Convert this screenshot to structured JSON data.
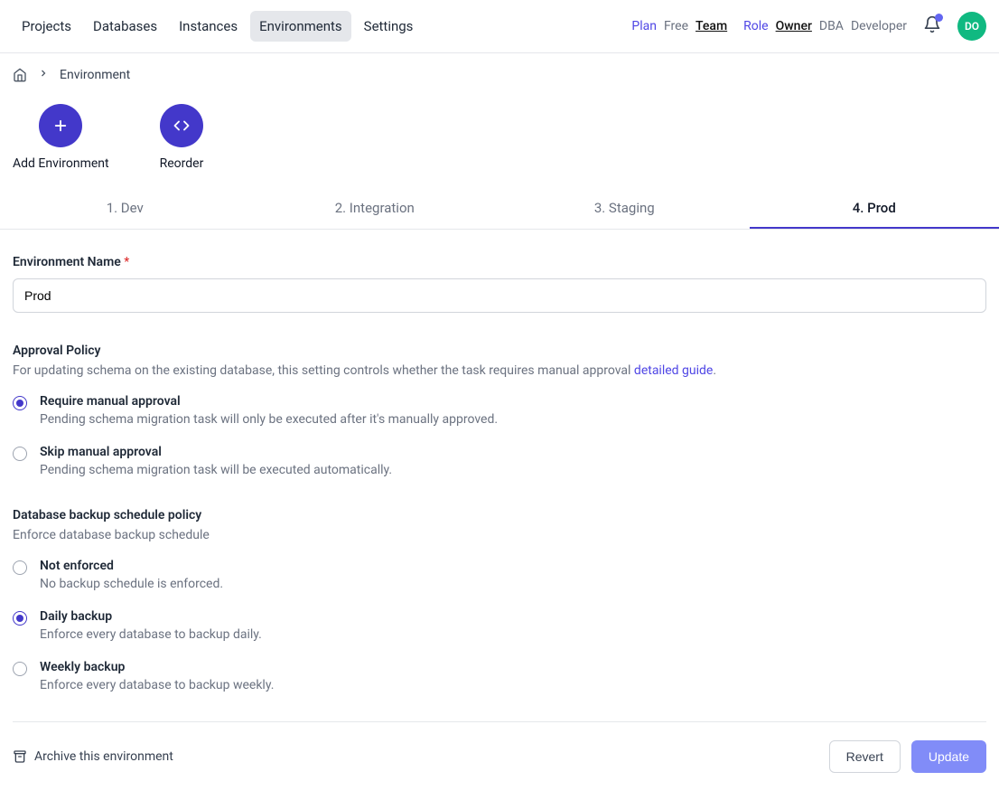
{
  "nav": {
    "items": [
      {
        "label": "Projects",
        "active": false
      },
      {
        "label": "Databases",
        "active": false
      },
      {
        "label": "Instances",
        "active": false
      },
      {
        "label": "Environments",
        "active": true
      },
      {
        "label": "Settings",
        "active": false
      }
    ],
    "plan_label": "Plan",
    "plan_free": "Free",
    "plan_team": "Team",
    "role_label": "Role",
    "role_owner": "Owner",
    "role_dba": "DBA",
    "role_developer": "Developer",
    "avatar_initials": "DO"
  },
  "breadcrumb": {
    "current": "Environment"
  },
  "actions": {
    "add": "Add Environment",
    "reorder": "Reorder"
  },
  "tabs": [
    {
      "label": "1. Dev",
      "active": false
    },
    {
      "label": "2. Integration",
      "active": false
    },
    {
      "label": "3. Staging",
      "active": false
    },
    {
      "label": "4. Prod",
      "active": true
    }
  ],
  "form": {
    "name_label": "Environment Name",
    "name_value": "Prod",
    "approval": {
      "title": "Approval Policy",
      "desc_prefix": "For updating schema on the existing database, this setting controls whether the task requires manual approval ",
      "link": "detailed guide",
      "desc_suffix": ".",
      "options": [
        {
          "title": "Require manual approval",
          "desc": "Pending schema migration task will only be executed after it's manually approved.",
          "checked": true
        },
        {
          "title": "Skip manual approval",
          "desc": "Pending schema migration task will be executed automatically.",
          "checked": false
        }
      ]
    },
    "backup": {
      "title": "Database backup schedule policy",
      "desc": "Enforce database backup schedule",
      "options": [
        {
          "title": "Not enforced",
          "desc": "No backup schedule is enforced.",
          "checked": false
        },
        {
          "title": "Daily backup",
          "desc": "Enforce every database to backup daily.",
          "checked": true
        },
        {
          "title": "Weekly backup",
          "desc": "Enforce every database to backup weekly.",
          "checked": false
        }
      ]
    }
  },
  "footer": {
    "archive": "Archive this environment",
    "revert": "Revert",
    "update": "Update"
  }
}
